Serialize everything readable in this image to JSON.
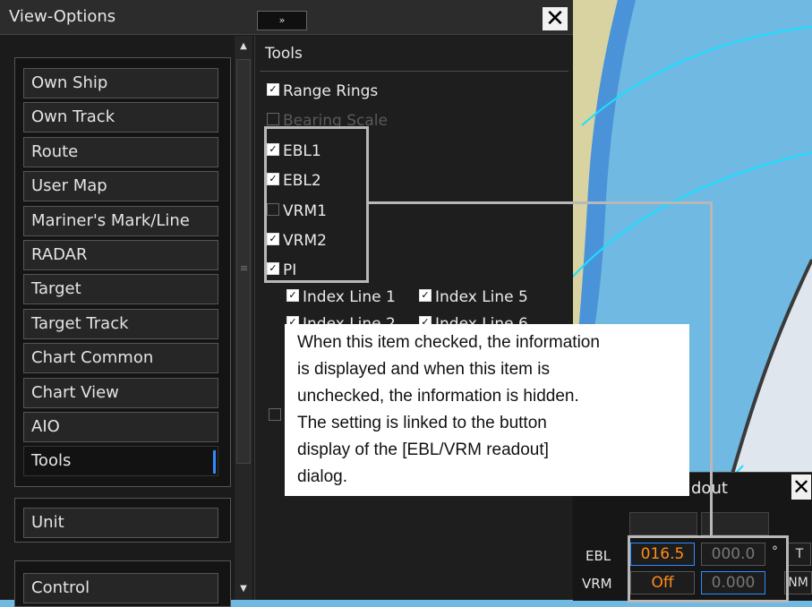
{
  "window": {
    "title": "View-Options",
    "collapse_glyph": "»",
    "close_glyph": "✕"
  },
  "nav": {
    "items": [
      "Own Ship",
      "Own Track",
      "Route",
      "User Map",
      "Mariner's Mark/Line",
      "RADAR",
      "Target",
      "Target Track",
      "Chart Common",
      "Chart View",
      "AIO",
      "Tools"
    ],
    "active": "Tools",
    "unit": "Unit",
    "control": "Control"
  },
  "scroll": {
    "up_glyph": "▲",
    "down_glyph": "▼",
    "grip_glyph": "≡"
  },
  "tools": {
    "title": "Tools",
    "range_rings": {
      "label": "Range Rings",
      "checked": true
    },
    "bearing_scale": {
      "label": "Bearing Scale",
      "checked": false
    },
    "ebl1": {
      "label": "EBL1",
      "checked": true
    },
    "ebl2": {
      "label": "EBL2",
      "checked": true
    },
    "vrm1": {
      "label": "VRM1",
      "checked": false
    },
    "vrm2": {
      "label": "VRM2",
      "checked": true
    },
    "pi": {
      "label": "PI",
      "checked": true
    },
    "index_line_1": {
      "label": "Index Line 1",
      "checked": true
    },
    "index_line_5": {
      "label": "Index Line 5",
      "checked": true
    },
    "index_line_2": {
      "label": "Index Line 2",
      "checked": true
    },
    "index_line_6": {
      "label": "Index Line 6",
      "checked": true
    }
  },
  "callout": {
    "lines": [
      "When this item checked, the information",
      "is displayed and when this item is",
      "unchecked, the information is hidden.",
      "The setting is linked to the button",
      "display of the [EBL/VRM readout]",
      "dialog."
    ]
  },
  "readout": {
    "title": "EBL/VRM Readout",
    "title_visible": "dout",
    "close_glyph": "✕",
    "ebl_label": "EBL",
    "vrm_label": "VRM",
    "ebl1_value": "016.5",
    "ebl2_value": "000.0",
    "vrm1_value": "Off",
    "vrm2_value": "0.000",
    "degree": "°",
    "true_mark": "T",
    "unit": "NM"
  },
  "colors": {
    "accent": "#2e8bff",
    "highlight_value": "#ff8c1a",
    "sea": "#6fb9e3",
    "land": "#d8d3a0"
  }
}
